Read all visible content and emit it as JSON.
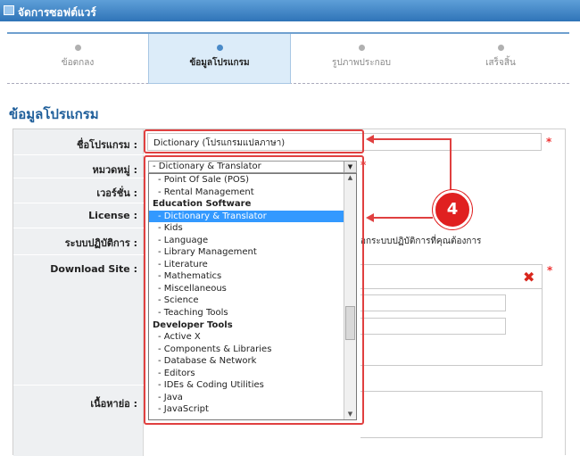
{
  "window": {
    "title": "จัดการซอฟต์แวร์"
  },
  "steps": [
    {
      "label": "ข้อตกลง",
      "active": false
    },
    {
      "label": "ข้อมูลโปรแกรม",
      "active": true
    },
    {
      "label": "รูปภาพประกอบ",
      "active": false
    },
    {
      "label": "เสร็จสิ้น",
      "active": false
    }
  ],
  "section": {
    "title": "ข้อมูลโปรแกรม"
  },
  "form": {
    "program_name_label": "ชื่อโปรแกรม :",
    "program_name_value": "Dictionary (โปรแกรมแปลภาษา)",
    "category_label": "หมวดหมู่ :",
    "category_value": "- Dictionary & Translator",
    "version_label": "เวอร์ชั่น :",
    "license_label": "License :",
    "os_label": "ระบบปฏิบัติการ :",
    "os_hint": "อกระบบปฏิบัติการที่คุณต้องการ",
    "download_label": "Download Site :",
    "summary_label": "เนื้อหาย่อ :",
    "required_mark": "*"
  },
  "dropdown": {
    "items": [
      {
        "text": "- Point Of Sale (POS)",
        "type": "item"
      },
      {
        "text": "- Rental Management",
        "type": "item"
      },
      {
        "text": "Education Software",
        "type": "group"
      },
      {
        "text": "- Dictionary & Translator",
        "type": "selected"
      },
      {
        "text": "- Kids",
        "type": "item"
      },
      {
        "text": "- Language",
        "type": "item"
      },
      {
        "text": "- Library Management",
        "type": "item"
      },
      {
        "text": "- Literature",
        "type": "item"
      },
      {
        "text": "- Mathematics",
        "type": "item"
      },
      {
        "text": "- Miscellaneous",
        "type": "item"
      },
      {
        "text": "- Science",
        "type": "item"
      },
      {
        "text": "- Teaching Tools",
        "type": "item"
      },
      {
        "text": "Developer Tools",
        "type": "group"
      },
      {
        "text": "- Active X",
        "type": "item"
      },
      {
        "text": "- Components & Libraries",
        "type": "item"
      },
      {
        "text": "- Database & Network",
        "type": "item"
      },
      {
        "text": "- Editors",
        "type": "item"
      },
      {
        "text": "- IDEs & Coding Utilities",
        "type": "item"
      },
      {
        "text": "- Java",
        "type": "item"
      },
      {
        "text": "- JavaScript",
        "type": "item"
      }
    ]
  },
  "annotation": {
    "number": "4"
  },
  "icons": {
    "remove": "close-x-icon",
    "dropdown_arrow": "chevron-down-icon"
  },
  "colors": {
    "titlebar": "#2f74b8",
    "accent": "#1e5e9a",
    "highlight": "#e04040",
    "selection": "#3399ff"
  }
}
